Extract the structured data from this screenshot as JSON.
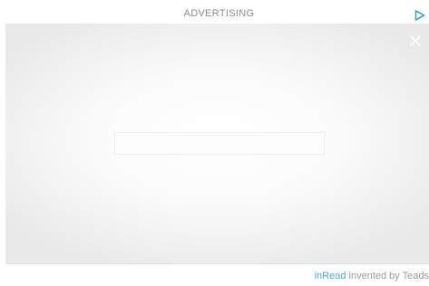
{
  "header": {
    "label": "ADVERTISING",
    "ad_choices_icon": "play-triangle-icon",
    "accent_color": "#1a9ad6"
  },
  "player": {
    "close_icon": "close-icon",
    "loading_bar": "empty"
  },
  "footer": {
    "brand_link": "inRead",
    "credit_text": " invented by Teads",
    "brand_color": "#4aa9d8"
  }
}
